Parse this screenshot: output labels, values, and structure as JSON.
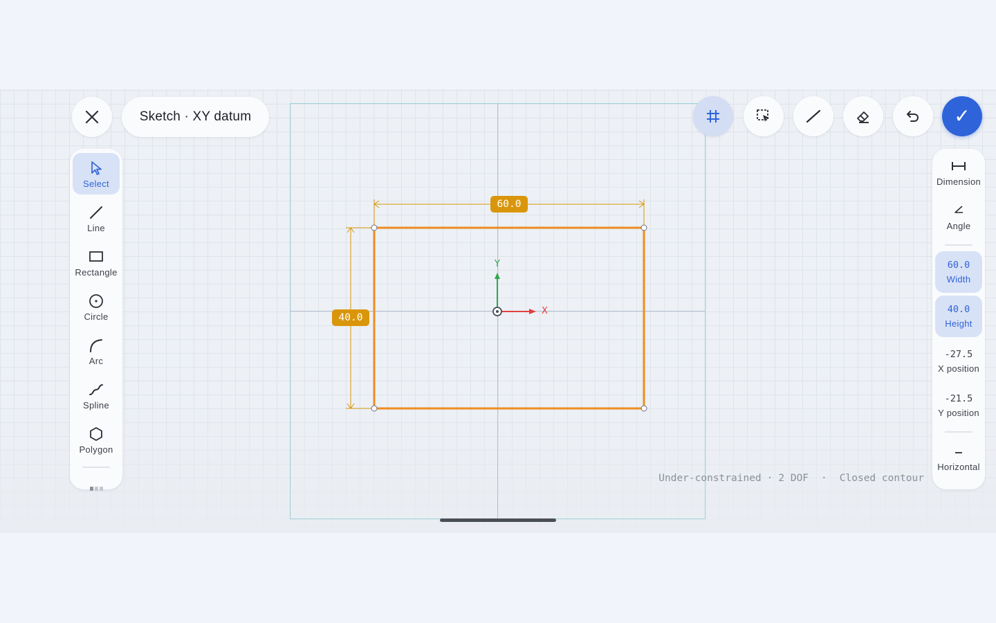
{
  "header": {
    "title": "Sketch · XY datum",
    "close_icon": "close-icon",
    "actions": [
      "grid-icon",
      "box-select-icon",
      "construction-line-icon",
      "eraser-icon",
      "undo-icon",
      "checkmark-icon"
    ],
    "confirm_glyph": "✓"
  },
  "tools": [
    {
      "label": "Select",
      "icon": "cursor-icon",
      "active": true
    },
    {
      "label": "Line",
      "icon": "line-icon"
    },
    {
      "label": "Rectangle",
      "icon": "rectangle-icon"
    },
    {
      "label": "Circle",
      "icon": "circle-icon"
    },
    {
      "label": "Arc",
      "icon": "arc-icon"
    },
    {
      "label": "Spline",
      "icon": "spline-icon"
    },
    {
      "label": "Polygon",
      "icon": "polygon-icon"
    }
  ],
  "properties": {
    "dimension": {
      "label": "Dimension",
      "icon": "dimension-icon"
    },
    "angle": {
      "label": "Angle",
      "icon": "angle-icon"
    },
    "width": {
      "value": "60.0",
      "label": "Width"
    },
    "height": {
      "value": "40.0",
      "label": "Height"
    },
    "x_position": {
      "value": "-27.5",
      "label": "X position"
    },
    "y_position": {
      "value": "-21.5",
      "label": "Y position"
    },
    "horizontal": {
      "label": "Horizontal",
      "icon": "horizontal-constraint-icon"
    }
  },
  "canvas": {
    "dim_width": "60.0",
    "dim_height": "40.0",
    "axis_x": "X",
    "axis_y": "Y"
  },
  "status": {
    "constraint": "Under-constrained",
    "dof": "2 DOF",
    "contour": "Closed contour",
    "dot": "·"
  },
  "colors": {
    "accent": "#2f63d9",
    "sketch": "#ef8d1f",
    "dimension": "#d9960b",
    "x_axis": "#e04040",
    "y_axis": "#2fa84f"
  }
}
